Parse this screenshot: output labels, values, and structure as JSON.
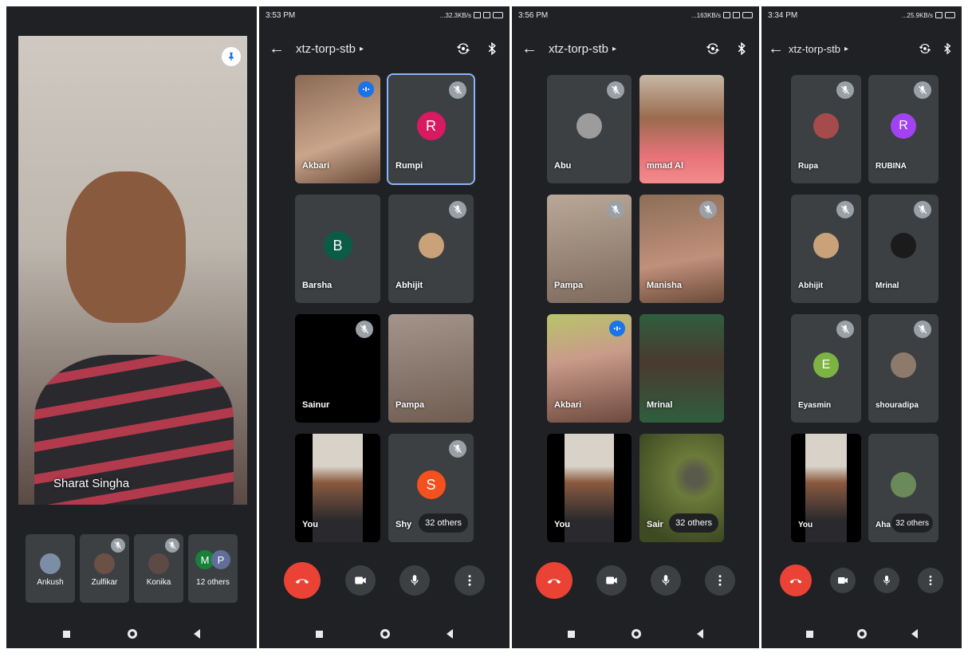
{
  "colors": {
    "background": "#202124",
    "tile": "#3c4043",
    "hangup": "#ea4335",
    "accent": "#1a73e8",
    "selected_outline": "#8ab4f8"
  },
  "icons": {
    "back": "arrow-left-icon",
    "switch_camera": "switch-camera-icon",
    "audio": "bluetooth-icon",
    "mute": "mic-off-icon",
    "speaking": "speaking-indicator-icon",
    "pin": "pin-icon",
    "hangup": "call-end-icon",
    "camera": "videocam-icon",
    "mic": "mic-icon",
    "more": "more-vert-icon"
  },
  "panel0": {
    "main_speaker": "Sharat Singha",
    "strip": [
      {
        "name": "Ankush"
      },
      {
        "name": "Zulfikar"
      },
      {
        "name": "Konika"
      },
      {
        "name": "12 others",
        "initials": [
          "M",
          "P"
        ]
      }
    ]
  },
  "panel1": {
    "status_time": "3:53 PM",
    "status_speed": "...32.3KB/s",
    "meeting_code": "xtz-torp-stb",
    "tiles": [
      {
        "name": "Akbari"
      },
      {
        "name": "Rumpi",
        "initial": "R"
      },
      {
        "name": "Barsha",
        "initial": "B"
      },
      {
        "name": "Abhijit"
      },
      {
        "name": "Sainur"
      },
      {
        "name": "Pampa"
      },
      {
        "name": "You"
      },
      {
        "name": "Shy",
        "initial": "S",
        "others": "32 others"
      }
    ]
  },
  "panel2": {
    "status_time": "3:56 PM",
    "status_speed": "...163KB/s",
    "meeting_code": "xtz-torp-stb",
    "tiles": [
      {
        "name": "Abu"
      },
      {
        "name": "mmad Al"
      },
      {
        "name": "Pampa"
      },
      {
        "name": "Manisha"
      },
      {
        "name": "Akbari"
      },
      {
        "name": "Mrinal"
      },
      {
        "name": "You"
      },
      {
        "name": "Sair",
        "others": "32 others"
      }
    ]
  },
  "panel3": {
    "status_time": "3:34 PM",
    "status_speed": "...25.9KB/s",
    "meeting_code": "xtz-torp-stb",
    "tiles": [
      {
        "name": "Rupa"
      },
      {
        "name": "RUBINA",
        "initial": "R"
      },
      {
        "name": "Abhijit"
      },
      {
        "name": "Mrinal"
      },
      {
        "name": "Eyasmin",
        "initial": "E"
      },
      {
        "name": "shouradipa"
      },
      {
        "name": "You"
      },
      {
        "name": "Aha",
        "others": "32 others"
      }
    ]
  }
}
